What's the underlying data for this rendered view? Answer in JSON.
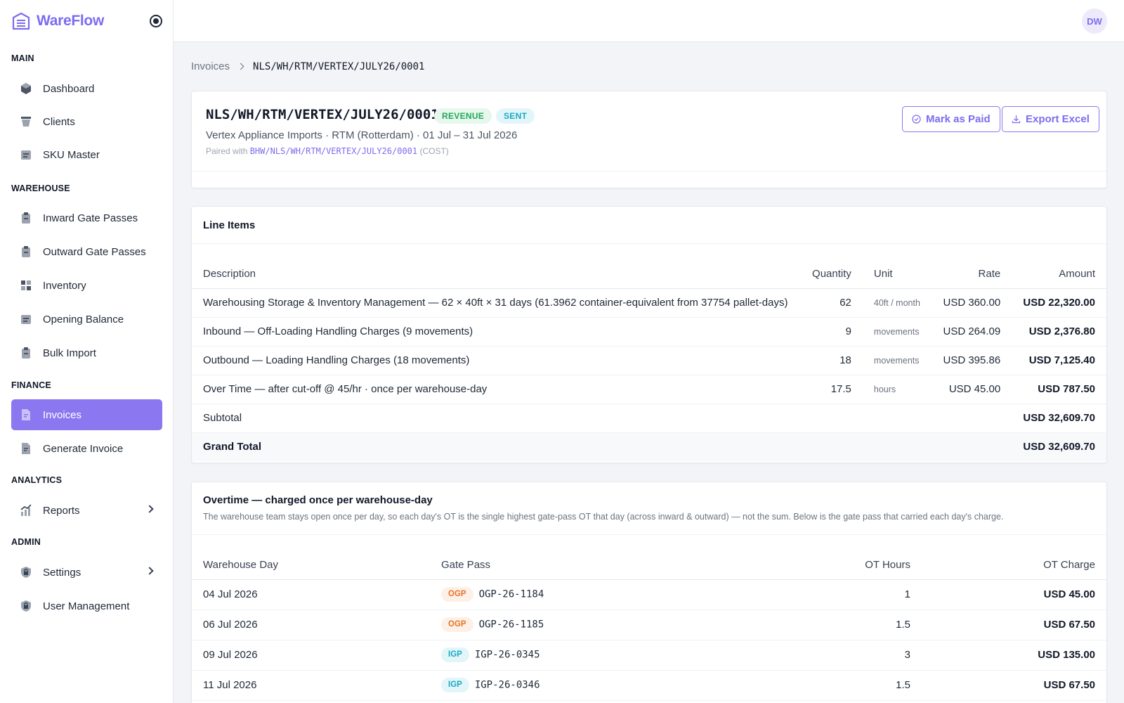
{
  "app": {
    "name": "WareFlow",
    "user_initials": "DW"
  },
  "sidebar": {
    "sections": {
      "main": "MAIN",
      "warehouse": "WAREHOUSE",
      "finance": "FINANCE",
      "analytics": "ANALYTICS",
      "admin": "ADMIN"
    },
    "items": {
      "dashboard": "Dashboard",
      "clients": "Clients",
      "sku_master": "SKU Master",
      "inward": "Inward Gate Passes",
      "outward": "Outward Gate Passes",
      "inventory": "Inventory",
      "opening_balance": "Opening Balance",
      "bulk_import": "Bulk Import",
      "invoices": "Invoices",
      "generate_invoice": "Generate Invoice",
      "reports": "Reports",
      "settings": "Settings",
      "user_management": "User Management"
    },
    "active": "invoices"
  },
  "breadcrumb": {
    "parent": "Invoices",
    "current": "NLS/WH/RTM/VERTEX/JULY26/0001"
  },
  "invoice": {
    "number": "NLS/WH/RTM/VERTEX/JULY26/0001",
    "type_badge": "REVENUE",
    "status_badge": "SENT",
    "client": "Vertex Appliance Imports",
    "dot1": " · ",
    "warehouse": "RTM (Rotterdam)",
    "period": " · 01 Jul – 31 Jul 2026",
    "paired_label": "Paired with ",
    "paired_number": "BHW/NLS/WH/RTM/VERTEX/JULY26/0001",
    "paired_type": " (COST)",
    "actions": {
      "mark_paid": "Mark as Paid",
      "export": "Export Excel"
    }
  },
  "line_items": {
    "title": "Line Items",
    "columns": {
      "description": "Description",
      "quantity": "Quantity",
      "unit": "Unit",
      "rate": "Rate",
      "amount": "Amount"
    },
    "rows": [
      {
        "description": "Warehousing Storage & Inventory Management — 62 × 40ft × 31 days (61.3962 container-equivalent from 37754 pallet-days)",
        "quantity": "62",
        "unit": "40ft / month",
        "rate": "USD 360.00",
        "amount": "USD 22,320.00"
      },
      {
        "description": "Inbound — Off-Loading Handling Charges (9 movements)",
        "quantity": "9",
        "unit": "movements",
        "rate": "USD 264.09",
        "amount": "USD 2,376.80"
      },
      {
        "description": "Outbound — Loading Handling Charges (18 movements)",
        "quantity": "18",
        "unit": "movements",
        "rate": "USD 395.86",
        "amount": "USD 7,125.40"
      },
      {
        "description": "Over Time — after cut-off @ 45/hr · once per warehouse-day",
        "quantity": "17.5",
        "unit": "hours",
        "rate": "USD 45.00",
        "amount": "USD 787.50"
      }
    ],
    "subtotal_label": "Subtotal",
    "subtotal": "USD 32,609.70",
    "grand_total_label": "Grand Total",
    "grand_total": "USD 32,609.70"
  },
  "overtime": {
    "title": "Overtime — charged once per warehouse-day",
    "description": "The warehouse team stays open once per day, so each day's OT is the single highest gate-pass OT that day (across inward & outward) — not the sum. Below is the gate pass that carried each day's charge.",
    "columns": {
      "day": "Warehouse Day",
      "gate_pass": "Gate Pass",
      "hours": "OT Hours",
      "charge": "OT Charge"
    },
    "rows": [
      {
        "day": "04 Jul 2026",
        "type": "OGP",
        "gate_pass": "OGP-26-1184",
        "hours": "1",
        "charge": "USD 45.00"
      },
      {
        "day": "06 Jul 2026",
        "type": "OGP",
        "gate_pass": "OGP-26-1185",
        "hours": "1.5",
        "charge": "USD 67.50"
      },
      {
        "day": "09 Jul 2026",
        "type": "IGP",
        "gate_pass": "IGP-26-0345",
        "hours": "3",
        "charge": "USD 135.00"
      },
      {
        "day": "11 Jul 2026",
        "type": "IGP",
        "gate_pass": "IGP-26-0346",
        "hours": "1.5",
        "charge": "USD 67.50"
      }
    ]
  },
  "colors": {
    "accent": "#7c6cf0",
    "active_bg": "#8b78f0",
    "revenue": "#22a85a",
    "sent": "#1aa9c2",
    "ogp": "#e8752a",
    "igp": "#1aa9c2"
  }
}
